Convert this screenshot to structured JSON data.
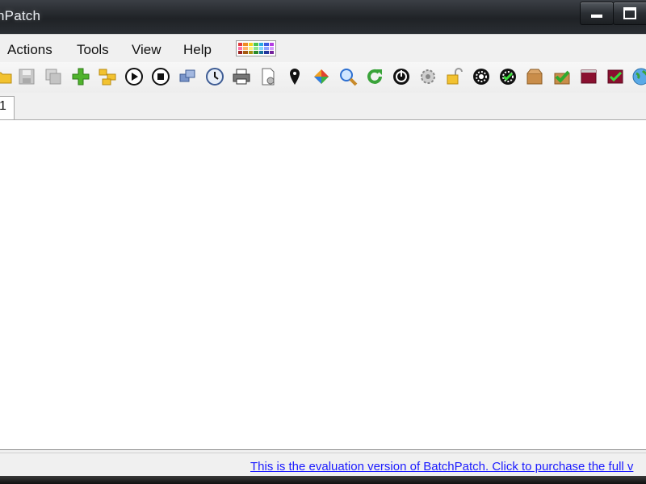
{
  "window": {
    "title": "hPatch"
  },
  "menu": {
    "items": [
      "Actions",
      "Tools",
      "View",
      "Help"
    ],
    "palette_colors": [
      "#e23b3b",
      "#f08a24",
      "#f2d41c",
      "#4cc64c",
      "#2aa7e6",
      "#3b5be2",
      "#b43be2",
      "#ff6fa8",
      "#ffb36b",
      "#fff07a",
      "#8ee68e",
      "#7fd6ff",
      "#8fa3ff",
      "#d59bff",
      "#9c2222",
      "#a55a12",
      "#a39010",
      "#2a8a2a",
      "#17719c",
      "#22369c",
      "#74229c"
    ]
  },
  "toolbar": {
    "icons": [
      "open-folder-icon",
      "save-icon",
      "copy-hosts-icon",
      "add-icon",
      "group-icon",
      "play-icon",
      "stop-icon",
      "deploy-icon",
      "schedule-clock-icon",
      "printer-icon",
      "settings-document-icon",
      "location-pin-icon",
      "windows-update-icon",
      "search-icon",
      "refresh-icon",
      "power-icon",
      "services-icon",
      "unlock-icon",
      "wheel-icon",
      "wheel-check-icon",
      "package-icon",
      "approve-icon",
      "console-icon",
      "console-check-icon",
      "globe-icon"
    ]
  },
  "tabs": {
    "active_label": "1"
  },
  "status": {
    "link_text": "This is the evaluation version of BatchPatch.  Click to purchase the full v"
  },
  "colors": {
    "titlebar": "#1f2226",
    "menubar": "#f0f0f0",
    "link": "#1a1aff"
  }
}
